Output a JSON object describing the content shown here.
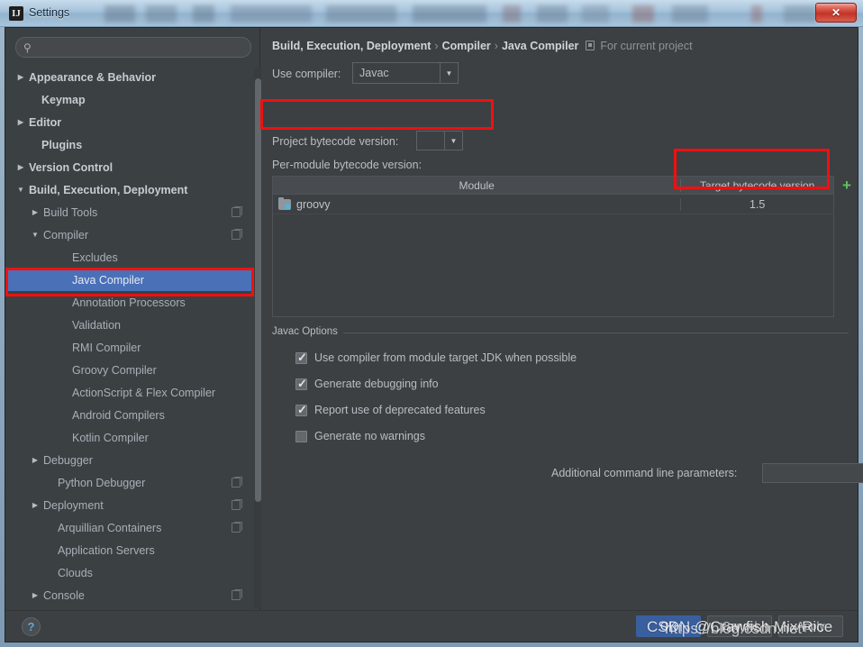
{
  "window": {
    "title": "Settings",
    "app_icon": "intellij-icon",
    "close_label": "✕"
  },
  "sidebar": {
    "search": {
      "placeholder": "",
      "value": "",
      "icon": "search-icon"
    },
    "items": [
      {
        "label": "Appearance & Behavior",
        "arrow": "▶",
        "indent": 26,
        "bold": true,
        "copy": false,
        "selected": false
      },
      {
        "label": "Keymap",
        "arrow": "",
        "indent": 40,
        "bold": true,
        "copy": false,
        "selected": false
      },
      {
        "label": "Editor",
        "arrow": "▶",
        "indent": 26,
        "bold": true,
        "copy": false,
        "selected": false
      },
      {
        "label": "Plugins",
        "arrow": "",
        "indent": 40,
        "bold": true,
        "copy": false,
        "selected": false
      },
      {
        "label": "Version Control",
        "arrow": "▶",
        "indent": 26,
        "bold": true,
        "copy": false,
        "selected": false
      },
      {
        "label": "Build, Execution, Deployment",
        "arrow": "▼",
        "indent": 26,
        "bold": true,
        "copy": false,
        "selected": false
      },
      {
        "label": "Build Tools",
        "arrow": "▶",
        "indent": 42,
        "bold": false,
        "copy": true,
        "selected": false
      },
      {
        "label": "Compiler",
        "arrow": "▼",
        "indent": 42,
        "bold": false,
        "copy": true,
        "selected": false
      },
      {
        "label": "Excludes",
        "arrow": "",
        "indent": 74,
        "bold": false,
        "copy": false,
        "selected": false
      },
      {
        "label": "Java Compiler",
        "arrow": "",
        "indent": 74,
        "bold": false,
        "copy": false,
        "selected": true
      },
      {
        "label": "Annotation Processors",
        "arrow": "",
        "indent": 74,
        "bold": false,
        "copy": false,
        "selected": false
      },
      {
        "label": "Validation",
        "arrow": "",
        "indent": 74,
        "bold": false,
        "copy": false,
        "selected": false
      },
      {
        "label": "RMI Compiler",
        "arrow": "",
        "indent": 74,
        "bold": false,
        "copy": false,
        "selected": false
      },
      {
        "label": "Groovy Compiler",
        "arrow": "",
        "indent": 74,
        "bold": false,
        "copy": false,
        "selected": false
      },
      {
        "label": "ActionScript & Flex Compiler",
        "arrow": "",
        "indent": 74,
        "bold": false,
        "copy": false,
        "selected": false
      },
      {
        "label": "Android Compilers",
        "arrow": "",
        "indent": 74,
        "bold": false,
        "copy": false,
        "selected": false
      },
      {
        "label": "Kotlin Compiler",
        "arrow": "",
        "indent": 74,
        "bold": false,
        "copy": false,
        "selected": false
      },
      {
        "label": "Debugger",
        "arrow": "▶",
        "indent": 42,
        "bold": false,
        "copy": false,
        "selected": false
      },
      {
        "label": "Python Debugger",
        "arrow": "",
        "indent": 58,
        "bold": false,
        "copy": true,
        "selected": false
      },
      {
        "label": "Deployment",
        "arrow": "▶",
        "indent": 42,
        "bold": false,
        "copy": true,
        "selected": false
      },
      {
        "label": "Arquillian Containers",
        "arrow": "",
        "indent": 58,
        "bold": false,
        "copy": true,
        "selected": false
      },
      {
        "label": "Application Servers",
        "arrow": "",
        "indent": 58,
        "bold": false,
        "copy": false,
        "selected": false
      },
      {
        "label": "Clouds",
        "arrow": "",
        "indent": 58,
        "bold": false,
        "copy": false,
        "selected": false
      },
      {
        "label": "Console",
        "arrow": "▶",
        "indent": 42,
        "bold": false,
        "copy": true,
        "selected": false
      }
    ]
  },
  "panel": {
    "breadcrumb": {
      "part1": "Build, Execution, Deployment",
      "sep1": "›",
      "part2": "Compiler",
      "sep2": "›",
      "part3": "Java Compiler",
      "scope": "For current project"
    },
    "use_compiler": {
      "label": "Use compiler:",
      "value": "Javac",
      "arrow": "▼"
    },
    "project_bytecode": {
      "label": "Project bytecode version:",
      "value": "",
      "arrow": "▼"
    },
    "per_module_label": "Per-module bytecode version:",
    "table": {
      "columns": [
        "Module",
        "Target bytecode version"
      ],
      "rows": [
        {
          "module": "groovy",
          "target": "1.5",
          "icon": "folder-module-icon"
        }
      ],
      "add_button": "+"
    },
    "javac_options": {
      "title": "Javac Options",
      "checkboxes": [
        {
          "label": "Use compiler from module target JDK when possible",
          "checked": true
        },
        {
          "label": "Generate debugging info",
          "checked": true
        },
        {
          "label": "Report use of deprecated features",
          "checked": true
        },
        {
          "label": "Generate no warnings",
          "checked": false
        }
      ],
      "additional_params": {
        "label": "Additional command line parameters:",
        "value": "",
        "placeholder": "",
        "expand_icon": "expand-editor-icon"
      }
    }
  },
  "footer": {
    "help": "?",
    "ok": "OK",
    "cancel": "Cancel",
    "apply": "Apply"
  },
  "watermark": {
    "line1": "CSDN @Crawfish Mix Rice",
    "line2": "https://blog.csdn.net"
  },
  "colors": {
    "accent_selection": "#4a70b8",
    "annotation_red": "#f01010",
    "panel_bg": "#3c4043",
    "sidebar_bg": "#3b4043",
    "add_green": "#5cc45c"
  }
}
